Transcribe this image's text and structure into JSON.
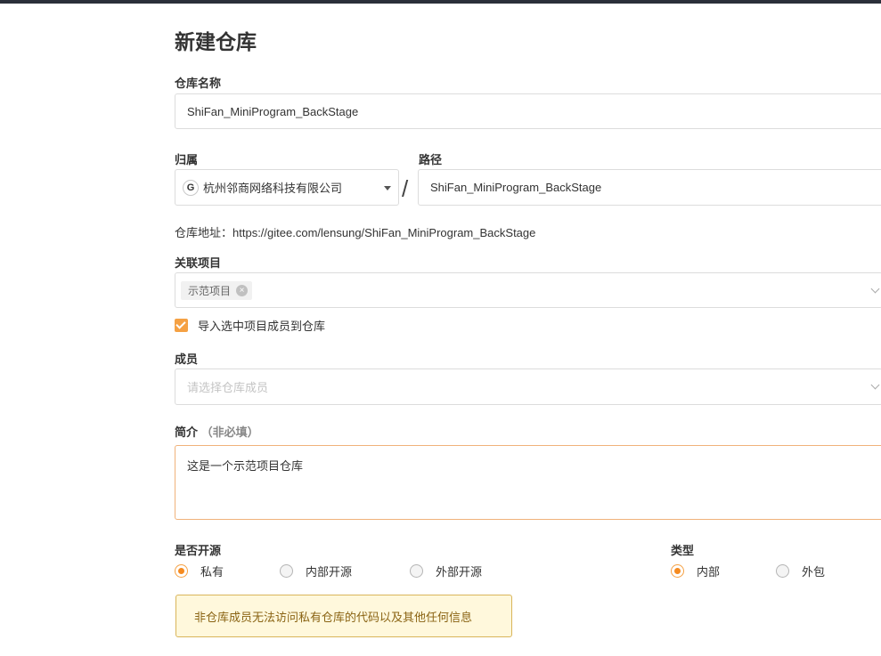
{
  "page": {
    "title": "新建仓库"
  },
  "repo_name": {
    "label": "仓库名称",
    "value": "ShiFan_MiniProgram_BackStage"
  },
  "owner": {
    "label": "归属",
    "value": "杭州邻商网络科技有限公司",
    "icon": "G"
  },
  "separator": "/",
  "path": {
    "label": "路径",
    "value": "ShiFan_MiniProgram_BackStage"
  },
  "repo_address": {
    "prefix": "仓库地址：",
    "url": "https://gitee.com/lensung/ShiFan_MiniProgram_BackStage"
  },
  "project": {
    "label": "关联项目",
    "tag": "示范项目",
    "tag_remove": "⊗"
  },
  "import_members": {
    "label": "导入选中项目成员到仓库",
    "checked": true
  },
  "members": {
    "label": "成员",
    "placeholder": "请选择仓库成员"
  },
  "description": {
    "label": "简介",
    "optional": "（非必填）",
    "value": "这是一个示范项目仓库"
  },
  "open_source": {
    "label": "是否开源",
    "options": [
      {
        "label": "私有",
        "selected": true
      },
      {
        "label": "内部开源",
        "selected": false
      },
      {
        "label": "外部开源",
        "selected": false
      }
    ]
  },
  "type": {
    "label": "类型",
    "options": [
      {
        "label": "内部",
        "selected": true
      },
      {
        "label": "外包",
        "selected": false
      }
    ]
  },
  "notice": "非仓库成员无法访问私有仓库的代码以及其他任何信息",
  "colors": {
    "accent": "#f58a1f",
    "notice_bg": "#fff8dc",
    "notice_border": "#d9b55a",
    "topbar": "#2b2f3a"
  }
}
